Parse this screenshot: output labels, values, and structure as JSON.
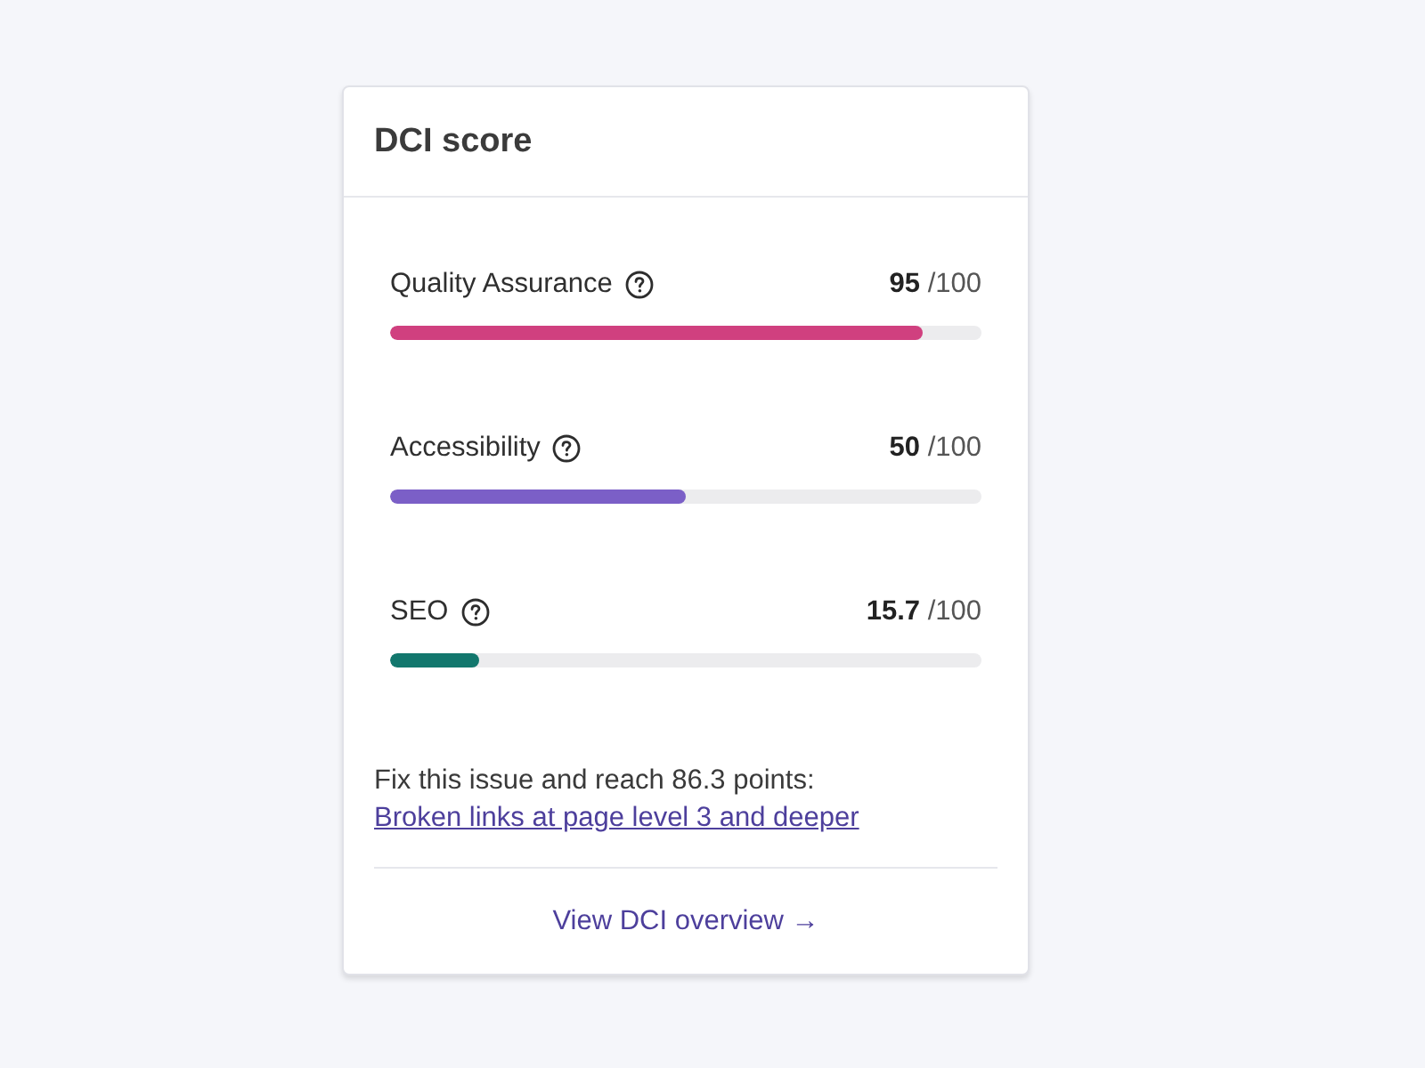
{
  "card": {
    "title": "DCI score"
  },
  "metrics": [
    {
      "label": "Quality Assurance",
      "score": "**95** /100",
      "level": 0.9,
      "color": "#d0407f"
    },
    {
      "label": "Accessibility",
      "score": "**50** /100",
      "level": 0.5,
      "color": "#7b5fc7"
    },
    {
      "label": "SEO",
      "score": "**15.7** /100",
      "level": 0.15,
      "color": "#12776d"
    }
  ],
  "hint": {
    "text": "Fix this issue and reach 86.3 points:",
    "link": "Broken links at page level 3 and deeper"
  },
  "footer_link": "View DCI overview →"
}
